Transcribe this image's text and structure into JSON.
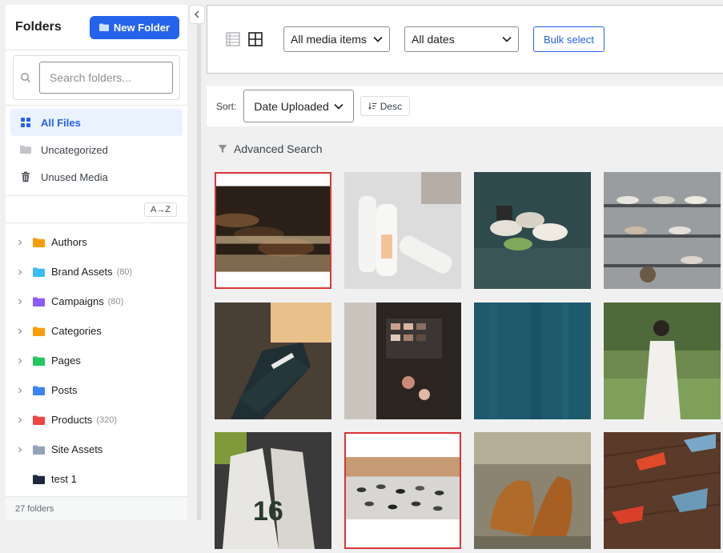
{
  "sidebar": {
    "title": "Folders",
    "new_folder_label": "New Folder",
    "search_placeholder": "Search folders...",
    "nav": [
      {
        "label": "All Files",
        "icon": "grid-icon",
        "active": true
      },
      {
        "label": "Uncategorized",
        "icon": "folder-icon"
      },
      {
        "label": "Unused Media",
        "icon": "trash-icon"
      }
    ],
    "sort_label": "A→Z",
    "folders": [
      {
        "label": "Authors",
        "count": "",
        "color": "#f59e0b",
        "expandable": true
      },
      {
        "label": "Brand Assets",
        "count": "(80)",
        "color": "#38bdf8",
        "expandable": true
      },
      {
        "label": "Campaigns",
        "count": "(80)",
        "color": "#8b5cf6",
        "expandable": true
      },
      {
        "label": "Categories",
        "count": "",
        "color": "#f59e0b",
        "expandable": true
      },
      {
        "label": "Pages",
        "count": "",
        "color": "#22c55e",
        "expandable": true
      },
      {
        "label": "Posts",
        "count": "",
        "color": "#3b82f6",
        "expandable": true
      },
      {
        "label": "Products",
        "count": "(320)",
        "color": "#ef4444",
        "expandable": true
      },
      {
        "label": "Site Assets",
        "count": "",
        "color": "#94a3b8",
        "expandable": true
      },
      {
        "label": "test 1",
        "count": "",
        "color": "#1e293b",
        "expandable": false
      }
    ],
    "footer": "27 folders"
  },
  "toolbar": {
    "media_filter": "All media items",
    "date_filter": "All dates",
    "bulk_label": "Bulk select"
  },
  "sortbar": {
    "label": "Sort:",
    "value": "Date Uploaded",
    "order": "Desc"
  },
  "advanced_search": "Advanced Search",
  "media": [
    {
      "name": "shoes-row-on-shelf",
      "selected": true
    },
    {
      "name": "skincare-bottles",
      "selected": false
    },
    {
      "name": "sneakers-pile",
      "selected": false
    },
    {
      "name": "shoe-rack-shelves",
      "selected": false
    },
    {
      "name": "converse-sneaker",
      "selected": false
    },
    {
      "name": "makeup-palette-table",
      "selected": false
    },
    {
      "name": "teal-texture",
      "selected": false
    },
    {
      "name": "woman-white-dress",
      "selected": false
    },
    {
      "name": "jerseys-rack",
      "selected": false
    },
    {
      "name": "shoe-store-display",
      "selected": true
    },
    {
      "name": "brown-leather-shoes",
      "selected": false
    },
    {
      "name": "red-heels-floor",
      "selected": false
    }
  ]
}
